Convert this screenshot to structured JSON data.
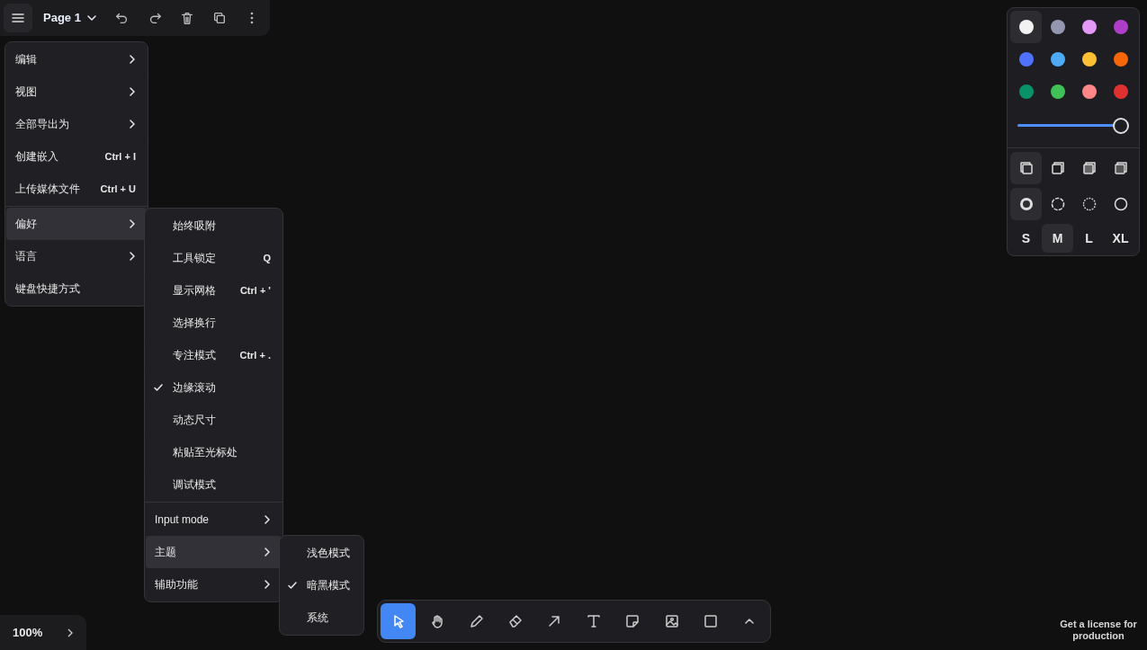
{
  "top_bar": {
    "page_name": "Page 1",
    "buttons": [
      {
        "kind": "undo"
      },
      {
        "kind": "redo"
      },
      {
        "kind": "delete"
      },
      {
        "kind": "duplicate"
      },
      {
        "kind": "more"
      }
    ]
  },
  "main_menu": {
    "groups": [
      [
        {
          "label": "编辑",
          "kind": "submenu",
          "expanded": false
        },
        {
          "label": "视图",
          "kind": "submenu",
          "expanded": false
        },
        {
          "label": "全部导出为",
          "kind": "submenu",
          "expanded": false
        },
        {
          "label": "创建嵌入",
          "kind": "shortcut",
          "shortcut": "Ctrl + I",
          "expanded": false
        },
        {
          "label": "上传媒体文件",
          "kind": "shortcut",
          "shortcut": "Ctrl + U",
          "expanded": false
        }
      ],
      [
        {
          "label": "偏好",
          "kind": "submenu",
          "expanded": true
        },
        {
          "label": "语言",
          "kind": "submenu",
          "expanded": false
        },
        {
          "label": "键盘快捷方式",
          "kind": "plain",
          "expanded": false
        }
      ]
    ]
  },
  "preferences_menu": {
    "groups": [
      [
        {
          "label": "始终吸附",
          "kind": "toggle",
          "checked": false
        },
        {
          "label": "工具锁定",
          "kind": "toggle",
          "checked": false,
          "shortcut": "Q"
        },
        {
          "label": "显示网格",
          "kind": "toggle",
          "checked": false,
          "shortcut": "Ctrl + '"
        },
        {
          "label": "选择换行",
          "kind": "toggle",
          "checked": false
        },
        {
          "label": "专注模式",
          "kind": "toggle",
          "checked": false,
          "shortcut": "Ctrl + ."
        },
        {
          "label": "边缘滚动",
          "kind": "toggle",
          "checked": true
        },
        {
          "label": "动态尺寸",
          "kind": "toggle",
          "checked": false
        },
        {
          "label": "粘贴至光标处",
          "kind": "toggle",
          "checked": false
        },
        {
          "label": "调试模式",
          "kind": "toggle",
          "checked": false
        }
      ],
      [
        {
          "label": "Input mode",
          "kind": "submenu",
          "expanded": false
        },
        {
          "label": "主题",
          "kind": "submenu",
          "expanded": true
        },
        {
          "label": "辅助功能",
          "kind": "submenu",
          "expanded": false
        }
      ]
    ]
  },
  "theme_menu": {
    "items": [
      {
        "label": "浅色模式",
        "checked": false
      },
      {
        "label": "暗黑模式",
        "checked": true
      },
      {
        "label": "系统",
        "checked": false
      }
    ]
  },
  "style_panel": {
    "colors": [
      {
        "color": "#f2f2f2",
        "selected": true
      },
      {
        "color": "#9398b0",
        "selected": false
      },
      {
        "color": "#e599f7",
        "selected": false
      },
      {
        "color": "#ae3ec9",
        "selected": false
      },
      {
        "color": "#4f72fc",
        "selected": false
      },
      {
        "color": "#4dabf7",
        "selected": false
      },
      {
        "color": "#ffc034",
        "selected": false
      },
      {
        "color": "#f76707",
        "selected": false
      },
      {
        "color": "#099268",
        "selected": false
      },
      {
        "color": "#40c057",
        "selected": false
      },
      {
        "color": "#ff8787",
        "selected": false
      },
      {
        "color": "#e03131",
        "selected": false
      }
    ],
    "opacity": {
      "level": 1
    },
    "fills": [
      {
        "kind": "none",
        "selected": true
      },
      {
        "kind": "semi",
        "selected": false
      },
      {
        "kind": "solid",
        "selected": false
      },
      {
        "kind": "pattern",
        "selected": false
      }
    ],
    "dashes": [
      {
        "kind": "draw",
        "selected": true
      },
      {
        "kind": "dashed",
        "selected": false
      },
      {
        "kind": "dotted",
        "selected": false
      },
      {
        "kind": "solid",
        "selected": false
      }
    ],
    "sizes": [
      {
        "label": "S",
        "selected": false
      },
      {
        "label": "M",
        "selected": true
      },
      {
        "label": "L",
        "selected": false
      },
      {
        "label": "XL",
        "selected": false
      }
    ]
  },
  "toolbar": {
    "tools": [
      {
        "kind": "select",
        "selected": true
      },
      {
        "kind": "hand",
        "selected": false
      },
      {
        "kind": "draw",
        "selected": false
      },
      {
        "kind": "eraser",
        "selected": false
      },
      {
        "kind": "arrow",
        "selected": false
      },
      {
        "kind": "text",
        "selected": false
      },
      {
        "kind": "note",
        "selected": false
      },
      {
        "kind": "image",
        "selected": false
      },
      {
        "kind": "rectangle",
        "selected": false
      },
      {
        "kind": "more",
        "selected": false
      }
    ]
  },
  "zoom": {
    "value": "100%"
  },
  "license_link": "Get a license for production"
}
